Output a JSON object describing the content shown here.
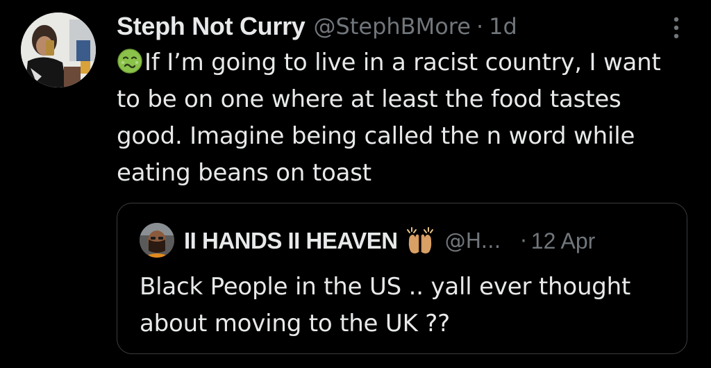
{
  "tweet": {
    "display_name": "Steph Not Curry",
    "handle": "@StephBMore",
    "separator": "·",
    "time": "1d",
    "emoji": "nauseated-face-emoji",
    "text": "If I’m going to live in a racist country, I want\nto be on one where at least the food tastes\ngood. Imagine being called the n word while\neating beans on toast",
    "more_icon": "vertical-ellipsis-icon"
  },
  "quoted": {
    "display_name": "II HANDS II HEAVEN",
    "name_emoji": "raising-hands-emoji",
    "handle": "@H...",
    "separator": "·",
    "time": "12 Apr",
    "text": "Black People in the US .. yall ever thought\nabout moving to the UK ??"
  },
  "colors": {
    "background": "#000000",
    "primary_text": "#e7e9ea",
    "secondary_text": "#71767b",
    "border": "#3a3d40"
  }
}
